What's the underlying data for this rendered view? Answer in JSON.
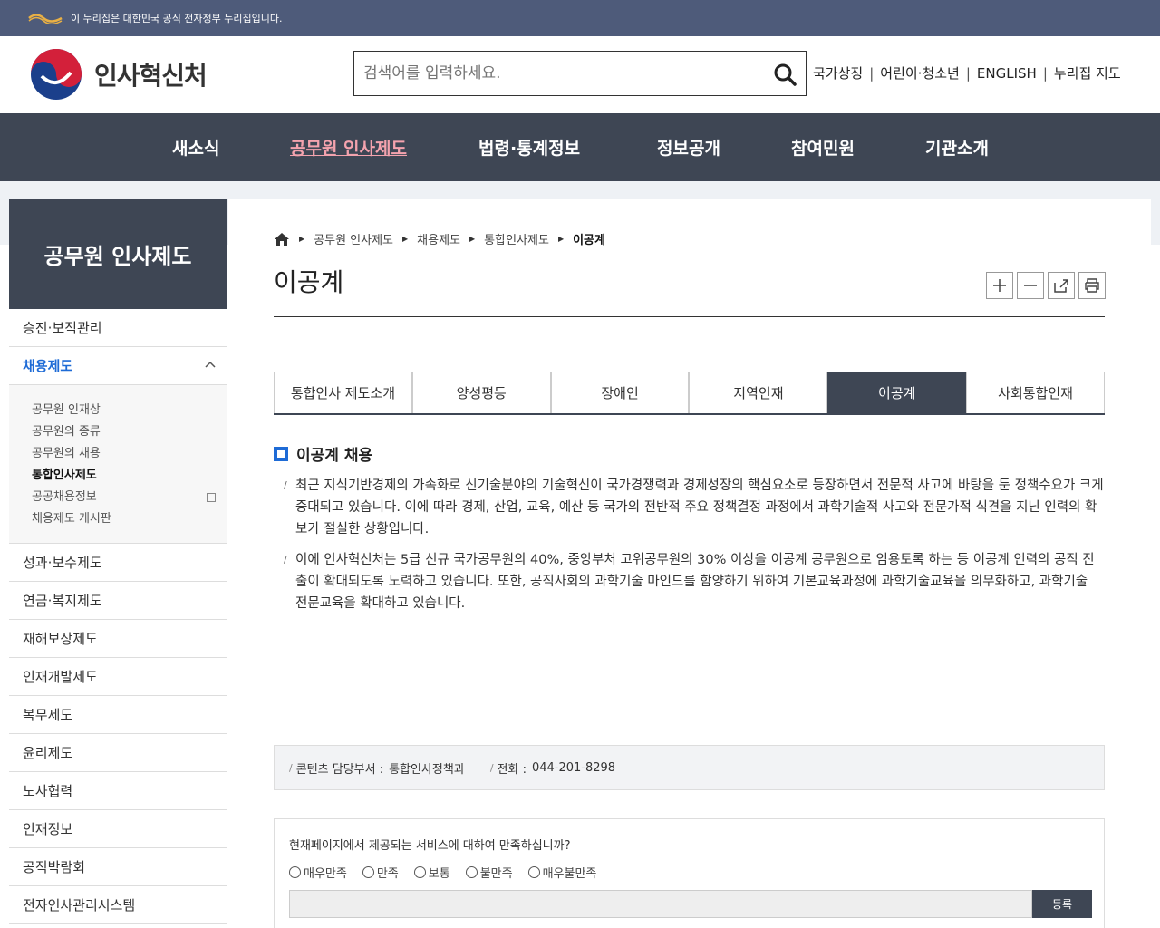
{
  "gov_banner": {
    "text": "이 누리집은 대한민국 공식 전자정부 누리집입니다."
  },
  "header": {
    "site_name": "인사혁신처",
    "search_placeholder": "검색어를 입력하세요.",
    "util_links": [
      "국가상징",
      "어린이·청소년",
      "ENGLISH",
      "누리집 지도"
    ]
  },
  "gnb": [
    "새소식",
    "공무원 인사제도",
    "법령·통계정보",
    "정보공개",
    "참여민원",
    "기관소개"
  ],
  "sidebar": {
    "title": "공무원 인사제도",
    "items_top": [
      "승진·보직관리",
      "채용제도"
    ],
    "sub_items": [
      "공무원 인재상",
      "공무원의 종류",
      "공무원의 채용",
      "통합인사제도",
      "공공채용정보",
      "채용제도 게시판"
    ],
    "items_bottom": [
      "성과·보수제도",
      "연금·복지제도",
      "재해보상제도",
      "인재개발제도",
      "복무제도",
      "윤리제도",
      "노사협력",
      "인재정보",
      "공직박람회",
      "전자인사관리시스템"
    ]
  },
  "breadcrumb": [
    "공무원 인사제도",
    "채용제도",
    "통합인사제도",
    "이공계"
  ],
  "page_title": "이공계",
  "tabs": [
    "통합인사 제도소개",
    "양성평등",
    "장애인",
    "지역인재",
    "이공계",
    "사회통합인재"
  ],
  "section_title": "이공계 채용",
  "paragraphs": [
    "최근 지식기반경제의 가속화로 신기술분야의 기술혁신이 국가경쟁력과 경제성장의 핵심요소로 등장하면서 전문적 사고에 바탕을 둔 정책수요가 크게 증대되고 있습니다. 이에 따라 경제, 산업, 교육, 예산 등 국가의 전반적 주요 정책결정 과정에서 과학기술적 사고와 전문가적 식견을 지닌 인력의 확보가 절실한 상황입니다.",
    "이에 인사혁신처는 5급 신규 국가공무원의 40%, 중앙부처 고위공무원의 30% 이상을 이공계 공무원으로 임용토록 하는 등 이공계 인력의 공직 진출이 확대되도록 노력하고 있습니다. 또한, 공직사회의 과학기술 마인드를 함양하기 위하여 기본교육과정에 과학기술교육을 의무화하고, 과학기술 전문교육을 확대하고 있습니다."
  ],
  "contact": {
    "dept_label": "콘텐츠 담당부서 :",
    "dept_value": "통합인사정책과",
    "phone_label": "전화 :",
    "phone_value": "044-201-8298"
  },
  "survey": {
    "question": "현재페이지에서 제공되는 서비스에 대하여 만족하십니까?",
    "options": [
      "매우만족",
      "만족",
      "보통",
      "불만족",
      "매우불만족"
    ],
    "submit_label": "등록"
  },
  "colors": {
    "navy": "#3e4654",
    "banner": "#4e5b7a",
    "accent_blue": "#1e6bd6",
    "active_menu": "#f4a3ae"
  }
}
